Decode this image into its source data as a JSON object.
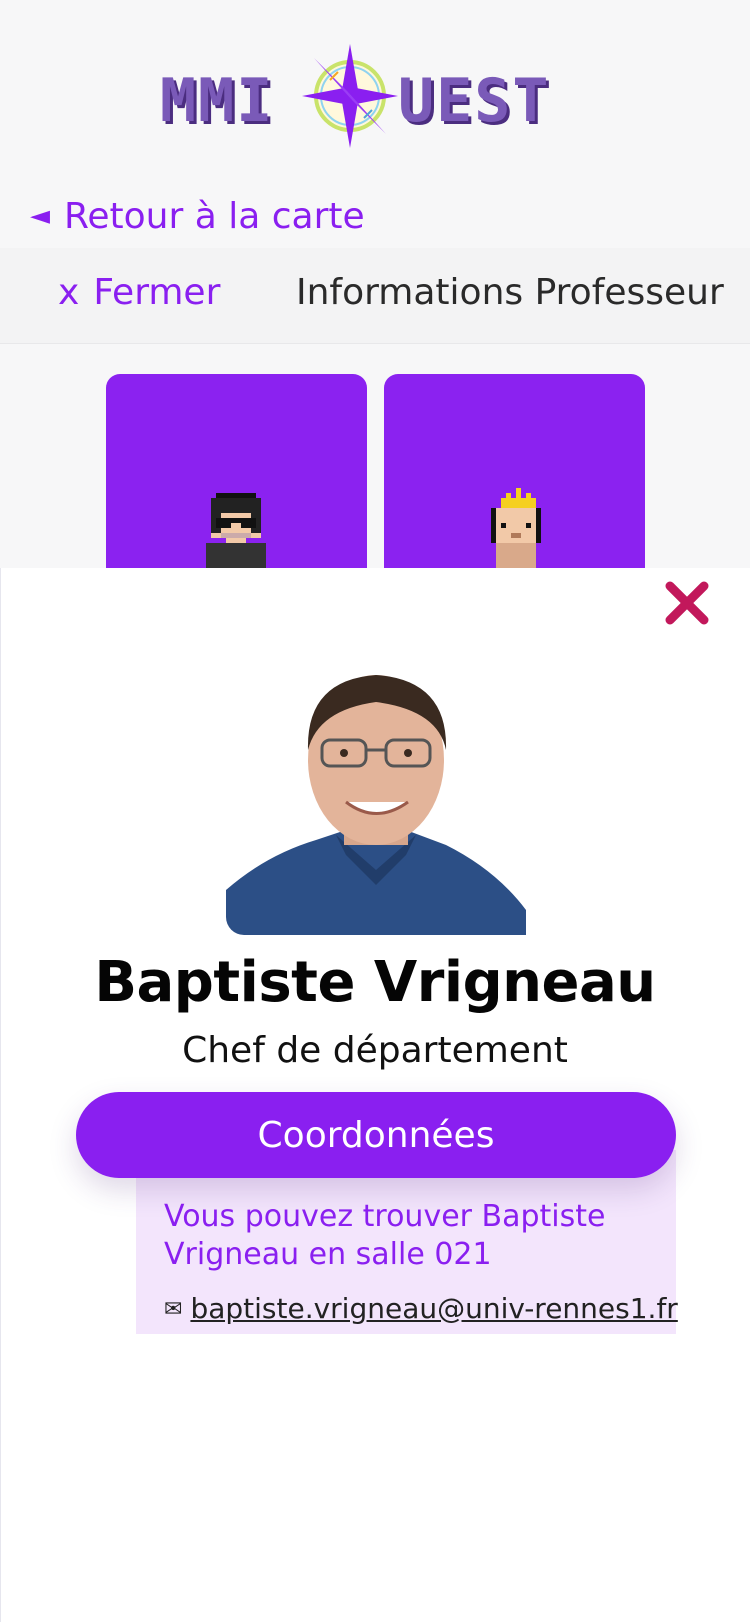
{
  "header": {
    "logo_left": "MMI",
    "logo_right": "UEST",
    "back_label": "Retour à la carte",
    "back_arrow": "◄"
  },
  "subheader": {
    "close_prefix": "x",
    "close_label": "Fermer",
    "title": "Informations Professeur"
  },
  "cards": [
    {
      "avatar": "pixel-avatar-glasses-icon"
    },
    {
      "avatar": "pixel-avatar-bald-crown-icon"
    }
  ],
  "profile": {
    "name": "Baptiste Vrigneau",
    "role": "Chef de département",
    "button_label": "Coordonnées",
    "location_text": "Vous pouvez trouver Baptiste Vrigneau en salle 021",
    "email_icon": "✉",
    "email": "baptiste.vrigneau@univ-rennes1.fr"
  },
  "colors": {
    "accent": "#8a1ff0",
    "close": "#c2185b",
    "panel": "#f3e5fc"
  }
}
